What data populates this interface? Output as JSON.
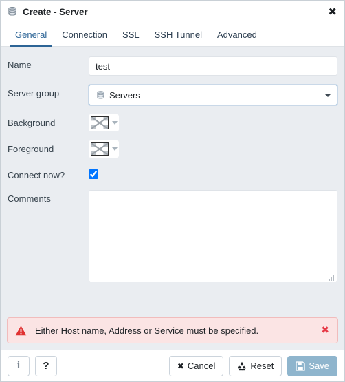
{
  "window": {
    "title": "Create - Server",
    "title_icon": "server-icon",
    "close_label": "✖"
  },
  "tabs": [
    {
      "label": "General",
      "active": true
    },
    {
      "label": "Connection",
      "active": false
    },
    {
      "label": "SSL",
      "active": false
    },
    {
      "label": "SSH Tunnel",
      "active": false
    },
    {
      "label": "Advanced",
      "active": false
    }
  ],
  "form": {
    "name": {
      "label": "Name",
      "value": "test",
      "placeholder": ""
    },
    "server_group": {
      "label": "Server group",
      "value": "Servers",
      "icon": "server-group-icon"
    },
    "background": {
      "label": "Background",
      "value": "",
      "swatch": "empty-checkered"
    },
    "foreground": {
      "label": "Foreground",
      "value": "",
      "swatch": "empty-checkered"
    },
    "connect_now": {
      "label": "Connect now?",
      "checked": true
    },
    "comments": {
      "label": "Comments",
      "value": "",
      "placeholder": ""
    }
  },
  "alert": {
    "icon": "warning-triangle-icon",
    "message": "Either Host name, Address or Service must be specified.",
    "close_label": "✖",
    "bg_color": "#fbe4e4",
    "border_color": "#f1bcbc",
    "icon_color": "#e03131"
  },
  "footer": {
    "info_label": "i",
    "help_label": "?",
    "cancel_label": "Cancel",
    "cancel_icon": "✖",
    "reset_label": "Reset",
    "reset_icon": "recycle-icon",
    "save_label": "Save",
    "save_icon": "floppy-disk-icon",
    "save_disabled": true,
    "save_color": "#8fb5cd"
  },
  "theme": {
    "accent": "#2c6496",
    "form_bg": "#eaedf1",
    "panel_bg": "#ffffff"
  }
}
